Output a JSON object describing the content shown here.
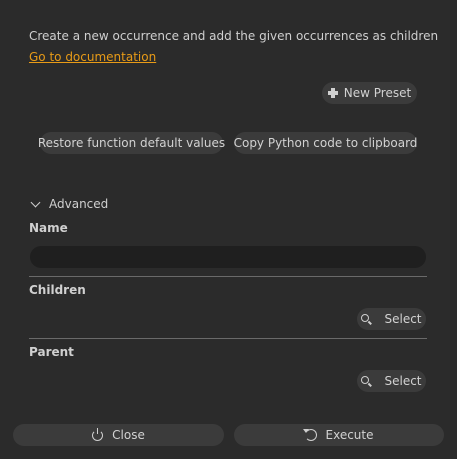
{
  "description": "Create a new occurrence and add the given occurrences as children",
  "doc_link": "Go to documentation",
  "presets": {
    "new_preset_label": "New Preset",
    "new_preset_icon": "plus-icon"
  },
  "actions": {
    "restore_label": "Restore function default values",
    "copy_label": "Copy Python code to clipboard"
  },
  "advanced": {
    "label": "Advanced",
    "expanded": true,
    "icon": "chevron-down-icon"
  },
  "fields": {
    "name": {
      "label": "Name",
      "value": "",
      "placeholder": ""
    },
    "children": {
      "label": "Children",
      "select_label": "Select",
      "icon": "search-icon"
    },
    "parent": {
      "label": "Parent",
      "select_label": "Select",
      "icon": "search-icon"
    }
  },
  "footer": {
    "close_label": "Close",
    "close_icon": "power-icon",
    "execute_label": "Execute",
    "execute_icon": "refresh-icon"
  },
  "colors": {
    "background": "#2b2b2b",
    "button": "#3b3b3b",
    "input": "#1f1f1f",
    "link": "#e89b17",
    "divider": "#6a6a6a"
  }
}
